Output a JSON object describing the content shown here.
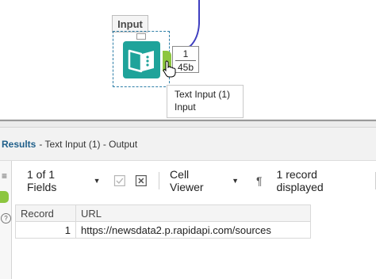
{
  "canvas": {
    "tool_caption": "Input",
    "output_count": "1",
    "output_size": "45b",
    "tooltip": {
      "line1": "Text Input (1)",
      "line2": "Input"
    }
  },
  "results": {
    "title": "Results",
    "subtitle": "- Text Input (1) - Output",
    "toolbar": {
      "fields_label": "1 of 1 Fields",
      "cell_viewer_label": "Cell Viewer",
      "pilcrow": "¶",
      "records_label": "1 record displayed"
    },
    "table": {
      "columns": [
        "Record",
        "URL"
      ],
      "rows": [
        {
          "record": "1",
          "url": "https://newsdata2.p.rapidapi.com/sources"
        }
      ]
    },
    "rail": {
      "menu_glyph": "≡",
      "help_glyph": "?"
    }
  },
  "colors": {
    "tool_teal": "#1fa39a",
    "anchor_green": "#8cc63f",
    "connector_blue": "#3f3fc0",
    "selection_blue": "#2f7fa8"
  },
  "icons": [
    "book-icon",
    "hand-cursor-icon",
    "checkbox-icon",
    "clear-x-icon",
    "chevron-down-icon",
    "pilcrow-icon",
    "menu-icon",
    "help-icon"
  ]
}
